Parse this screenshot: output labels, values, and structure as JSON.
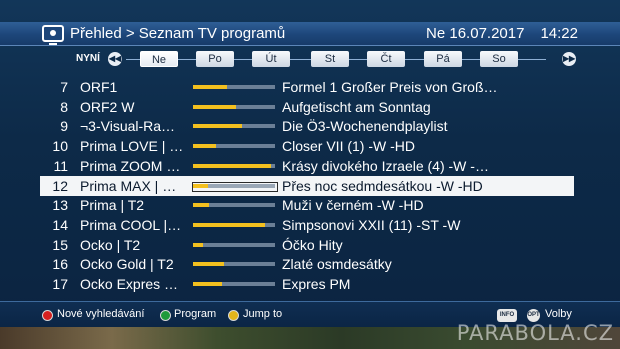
{
  "header": {
    "breadcrumb": "Přehled > Seznam TV programů",
    "date": "Ne 16.07.2017",
    "time": "14:22",
    "icon": "tv-icon"
  },
  "daybar": {
    "now_label": "NYNÍ",
    "prev_arrow": "◀◀",
    "next_arrow": "▶▶",
    "days": [
      "Ne",
      "Po",
      "Út",
      "St",
      "Čt",
      "Pá",
      "So"
    ],
    "active_day": "Ne"
  },
  "rows": [
    {
      "num": "7",
      "channel": "ORF1",
      "program": "Formel 1 Großer Preis von Groß…",
      "progress": 0.42
    },
    {
      "num": "8",
      "channel": "ORF2 W",
      "program": "Aufgetischt am Sonntag",
      "progress": 0.52
    },
    {
      "num": "9",
      "channel": "¬3-Visual-Ra…",
      "program": "Die Ö3-Wochenendplaylist",
      "progress": 0.6
    },
    {
      "num": "10",
      "channel": "Prima LOVE | …",
      "program": "Closer VII (1) -W -HD",
      "progress": 0.28
    },
    {
      "num": "11",
      "channel": "Prima ZOOM …",
      "program": "Krásy divokého Izraele (4) -W -…",
      "progress": 0.95
    },
    {
      "num": "12",
      "channel": "Prima MAX | …",
      "program": "Přes noc sedmdesátkou -W -HD",
      "progress": 0.18,
      "selected": true
    },
    {
      "num": "13",
      "channel": "Prima | T2",
      "program": "Muži v černém -W -HD",
      "progress": 0.2
    },
    {
      "num": "14",
      "channel": "Prima COOL |…",
      "program": "Simpsonovi XXII (11) -ST -W",
      "progress": 0.88
    },
    {
      "num": "15",
      "channel": "Ocko | T2",
      "program": "Óčko Hity",
      "progress": 0.12
    },
    {
      "num": "16",
      "channel": "Ocko Gold | T2",
      "program": "Zlaté osmdesátky",
      "progress": 0.38
    },
    {
      "num": "17",
      "channel": "Ocko Expres …",
      "program": "Expres PM",
      "progress": 0.35
    }
  ],
  "footer": {
    "red_label": "Nové vyhledávání",
    "green_label": "Program",
    "yellow_label": "Jump to",
    "info_badge": "INFO",
    "opt_badge": "OPT",
    "options_label": "Volby",
    "colors": {
      "red": "#d42020",
      "green": "#1f9a3a",
      "yellow": "#e3b51a"
    }
  },
  "watermark": "PARABOLA.CZ",
  "colors": {
    "progress_fill": "#f3c01f",
    "selection_bg": "#f3f5f7"
  }
}
